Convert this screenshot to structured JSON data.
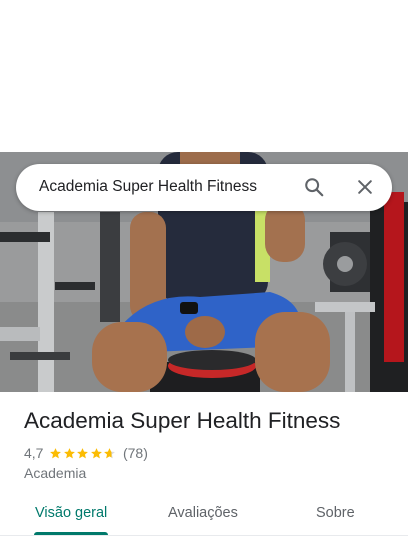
{
  "search": {
    "query": "Academia Super Health Fitness"
  },
  "place": {
    "name": "Academia Super Health Fitness",
    "rating": "4,7",
    "rating_value": 4.7,
    "review_count": "(78)",
    "category": "Academia"
  },
  "tabs": [
    {
      "label": "Visão geral",
      "active": true
    },
    {
      "label": "Avaliações",
      "active": false
    },
    {
      "label": "Sobre",
      "active": false
    }
  ],
  "colors": {
    "accent": "#00796b",
    "star": "#fbbc04",
    "text_secondary": "#70757a"
  },
  "icons": [
    "search-icon",
    "close-icon",
    "star-icon"
  ]
}
